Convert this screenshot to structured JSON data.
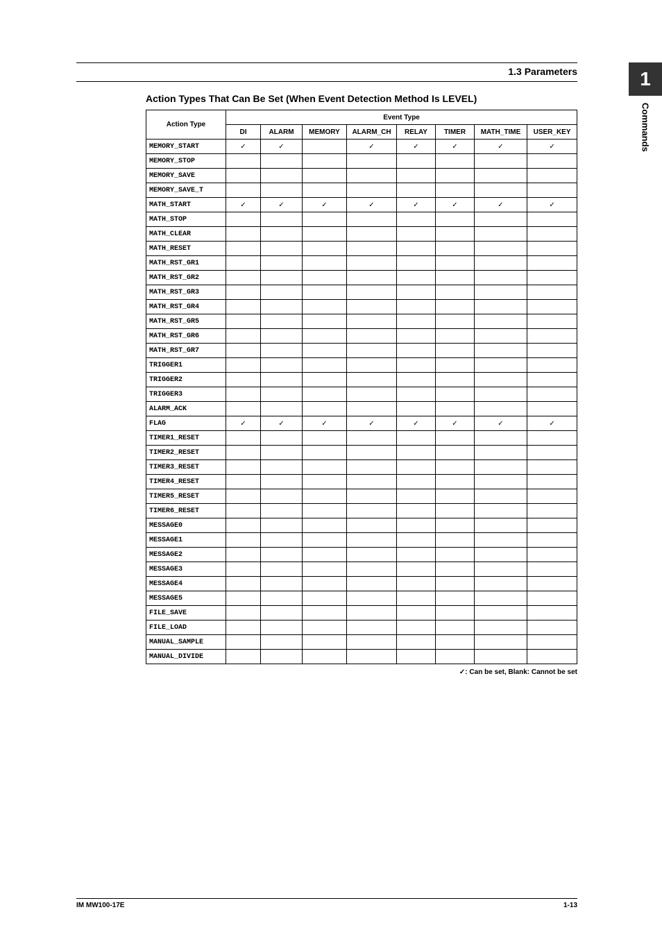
{
  "section_header": "1.3  Parameters",
  "title": "Action Types That Can Be Set (When Event Detection Method Is LEVEL)",
  "side": {
    "number": "1",
    "label": "Commands"
  },
  "footer": {
    "left": "IM MW100-17E",
    "right": "1-13"
  },
  "legend": "✓: Can be set, Blank: Cannot be set",
  "table": {
    "corner": "Action Type",
    "event_header": "Event Type",
    "cols": [
      "DI",
      "ALARM",
      "MEMORY",
      "ALARM_CH",
      "RELAY",
      "TIMER",
      "MATH_TIME",
      "USER_KEY"
    ],
    "rows": [
      {
        "name": "MEMORY_START",
        "v": [
          "✓",
          "✓",
          "",
          "✓",
          "✓",
          "✓",
          "✓",
          "✓"
        ]
      },
      {
        "name": "MEMORY_STOP",
        "v": [
          "",
          "",
          "",
          "",
          "",
          "",
          "",
          ""
        ]
      },
      {
        "name": "MEMORY_SAVE",
        "v": [
          "",
          "",
          "",
          "",
          "",
          "",
          "",
          ""
        ]
      },
      {
        "name": "MEMORY_SAVE_T",
        "v": [
          "",
          "",
          "",
          "",
          "",
          "",
          "",
          ""
        ]
      },
      {
        "name": "MATH_START",
        "v": [
          "✓",
          "✓",
          "✓",
          "✓",
          "✓",
          "✓",
          "✓",
          "✓"
        ]
      },
      {
        "name": "MATH_STOP",
        "v": [
          "",
          "",
          "",
          "",
          "",
          "",
          "",
          ""
        ]
      },
      {
        "name": "MATH_CLEAR",
        "v": [
          "",
          "",
          "",
          "",
          "",
          "",
          "",
          ""
        ]
      },
      {
        "name": "MATH_RESET",
        "v": [
          "",
          "",
          "",
          "",
          "",
          "",
          "",
          ""
        ]
      },
      {
        "name": "MATH_RST_GR1",
        "v": [
          "",
          "",
          "",
          "",
          "",
          "",
          "",
          ""
        ]
      },
      {
        "name": "MATH_RST_GR2",
        "v": [
          "",
          "",
          "",
          "",
          "",
          "",
          "",
          ""
        ]
      },
      {
        "name": "MATH_RST_GR3",
        "v": [
          "",
          "",
          "",
          "",
          "",
          "",
          "",
          ""
        ]
      },
      {
        "name": "MATH_RST_GR4",
        "v": [
          "",
          "",
          "",
          "",
          "",
          "",
          "",
          ""
        ]
      },
      {
        "name": "MATH_RST_GR5",
        "v": [
          "",
          "",
          "",
          "",
          "",
          "",
          "",
          ""
        ]
      },
      {
        "name": "MATH_RST_GR6",
        "v": [
          "",
          "",
          "",
          "",
          "",
          "",
          "",
          ""
        ]
      },
      {
        "name": "MATH_RST_GR7",
        "v": [
          "",
          "",
          "",
          "",
          "",
          "",
          "",
          ""
        ]
      },
      {
        "name": "TRIGGER1",
        "v": [
          "",
          "",
          "",
          "",
          "",
          "",
          "",
          ""
        ]
      },
      {
        "name": "TRIGGER2",
        "v": [
          "",
          "",
          "",
          "",
          "",
          "",
          "",
          ""
        ]
      },
      {
        "name": "TRIGGER3",
        "v": [
          "",
          "",
          "",
          "",
          "",
          "",
          "",
          ""
        ]
      },
      {
        "name": "ALARM_ACK",
        "v": [
          "",
          "",
          "",
          "",
          "",
          "",
          "",
          ""
        ]
      },
      {
        "name": "FLAG",
        "v": [
          "✓",
          "✓",
          "✓",
          "✓",
          "✓",
          "✓",
          "✓",
          "✓"
        ]
      },
      {
        "name": "TIMER1_RESET",
        "v": [
          "",
          "",
          "",
          "",
          "",
          "",
          "",
          ""
        ]
      },
      {
        "name": "TIMER2_RESET",
        "v": [
          "",
          "",
          "",
          "",
          "",
          "",
          "",
          ""
        ]
      },
      {
        "name": "TIMER3_RESET",
        "v": [
          "",
          "",
          "",
          "",
          "",
          "",
          "",
          ""
        ]
      },
      {
        "name": "TIMER4_RESET",
        "v": [
          "",
          "",
          "",
          "",
          "",
          "",
          "",
          ""
        ]
      },
      {
        "name": "TIMER5_RESET",
        "v": [
          "",
          "",
          "",
          "",
          "",
          "",
          "",
          ""
        ]
      },
      {
        "name": "TIMER6_RESET",
        "v": [
          "",
          "",
          "",
          "",
          "",
          "",
          "",
          ""
        ]
      },
      {
        "name": "MESSAGE0",
        "v": [
          "",
          "",
          "",
          "",
          "",
          "",
          "",
          ""
        ]
      },
      {
        "name": "MESSAGE1",
        "v": [
          "",
          "",
          "",
          "",
          "",
          "",
          "",
          ""
        ]
      },
      {
        "name": "MESSAGE2",
        "v": [
          "",
          "",
          "",
          "",
          "",
          "",
          "",
          ""
        ]
      },
      {
        "name": "MESSAGE3",
        "v": [
          "",
          "",
          "",
          "",
          "",
          "",
          "",
          ""
        ]
      },
      {
        "name": "MESSAGE4",
        "v": [
          "",
          "",
          "",
          "",
          "",
          "",
          "",
          ""
        ]
      },
      {
        "name": "MESSAGE5",
        "v": [
          "",
          "",
          "",
          "",
          "",
          "",
          "",
          ""
        ]
      },
      {
        "name": "FILE_SAVE",
        "v": [
          "",
          "",
          "",
          "",
          "",
          "",
          "",
          ""
        ]
      },
      {
        "name": "FILE_LOAD",
        "v": [
          "",
          "",
          "",
          "",
          "",
          "",
          "",
          ""
        ]
      },
      {
        "name": "MANUAL_SAMPLE",
        "v": [
          "",
          "",
          "",
          "",
          "",
          "",
          "",
          ""
        ]
      },
      {
        "name": "MANUAL_DIVIDE",
        "v": [
          "",
          "",
          "",
          "",
          "",
          "",
          "",
          ""
        ]
      }
    ]
  }
}
